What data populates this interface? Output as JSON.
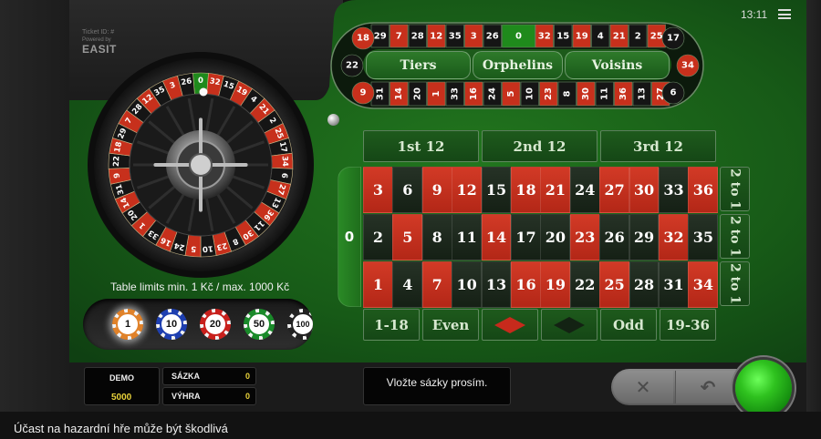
{
  "status_bar": {
    "time": "13:11"
  },
  "ticket": {
    "ticket_label": "Ticket ID: #",
    "powered_label": "Powered by",
    "brand": "EASIT"
  },
  "wheel": {
    "sequence": [
      "0",
      "32",
      "15",
      "19",
      "4",
      "21",
      "2",
      "25",
      "17",
      "34",
      "6",
      "27",
      "13",
      "36",
      "11",
      "30",
      "8",
      "23",
      "10",
      "5",
      "24",
      "16",
      "33",
      "1",
      "20",
      "14",
      "31",
      "9",
      "22",
      "18",
      "29",
      "7",
      "28",
      "12",
      "35",
      "3",
      "26"
    ]
  },
  "racetrack": {
    "top_row": [
      "29",
      "7",
      "28",
      "12",
      "35",
      "3",
      "26",
      "0",
      "32",
      "15",
      "19",
      "4",
      "21",
      "2",
      "25"
    ],
    "bottom_row": [
      "31",
      "14",
      "20",
      "1",
      "33",
      "16",
      "24",
      "5",
      "10",
      "23",
      "8",
      "30",
      "11",
      "36",
      "13",
      "27"
    ],
    "left_cap": [
      "18",
      "22",
      "9"
    ],
    "right_cap": [
      "17",
      "34",
      "6"
    ],
    "sections": [
      "Tiers",
      "Orphelins",
      "Voisins"
    ]
  },
  "board": {
    "zero": "0",
    "rows": [
      [
        "3",
        "6",
        "9",
        "12",
        "15",
        "18",
        "21",
        "24",
        "27",
        "30",
        "33",
        "36"
      ],
      [
        "2",
        "5",
        "8",
        "11",
        "14",
        "17",
        "20",
        "23",
        "26",
        "29",
        "32",
        "35"
      ],
      [
        "1",
        "4",
        "7",
        "10",
        "13",
        "16",
        "19",
        "22",
        "25",
        "28",
        "31",
        "34"
      ]
    ],
    "red_numbers": [
      "1",
      "3",
      "5",
      "7",
      "9",
      "12",
      "14",
      "16",
      "18",
      "19",
      "21",
      "23",
      "25",
      "27",
      "30",
      "32",
      "34",
      "36"
    ],
    "dozens": [
      "1st  12",
      "2nd  12",
      "3rd  12"
    ],
    "columns": [
      "2 to 1",
      "2 to 1",
      "2 to 1"
    ],
    "even_money": [
      "1-18",
      "Even",
      "",
      "",
      "Odd",
      "19-36"
    ]
  },
  "table_limits": "Table limits min. 1 Kč / max. 1000 Kč",
  "chips": [
    {
      "value": "1",
      "color": "#e0822a"
    },
    {
      "value": "10",
      "color": "#1e3fb0"
    },
    {
      "value": "20",
      "color": "#c8201c"
    },
    {
      "value": "50",
      "color": "#1a8a2a"
    },
    {
      "value": "100",
      "color": "#222222"
    }
  ],
  "hud": {
    "demo_label": "DEMO",
    "demo_balance": "5000",
    "bet_label": "SÁZKA",
    "bet_value": "0",
    "win_label": "VÝHRA",
    "win_value": "0",
    "message": "Vložte sázky prosím."
  },
  "colors": {
    "accent_green": "#1f6e1c",
    "red": "#c7301c",
    "yellow": "#e8d23a"
  },
  "footer": {
    "warning": "Účast na hazardní hře může být škodlivá"
  }
}
